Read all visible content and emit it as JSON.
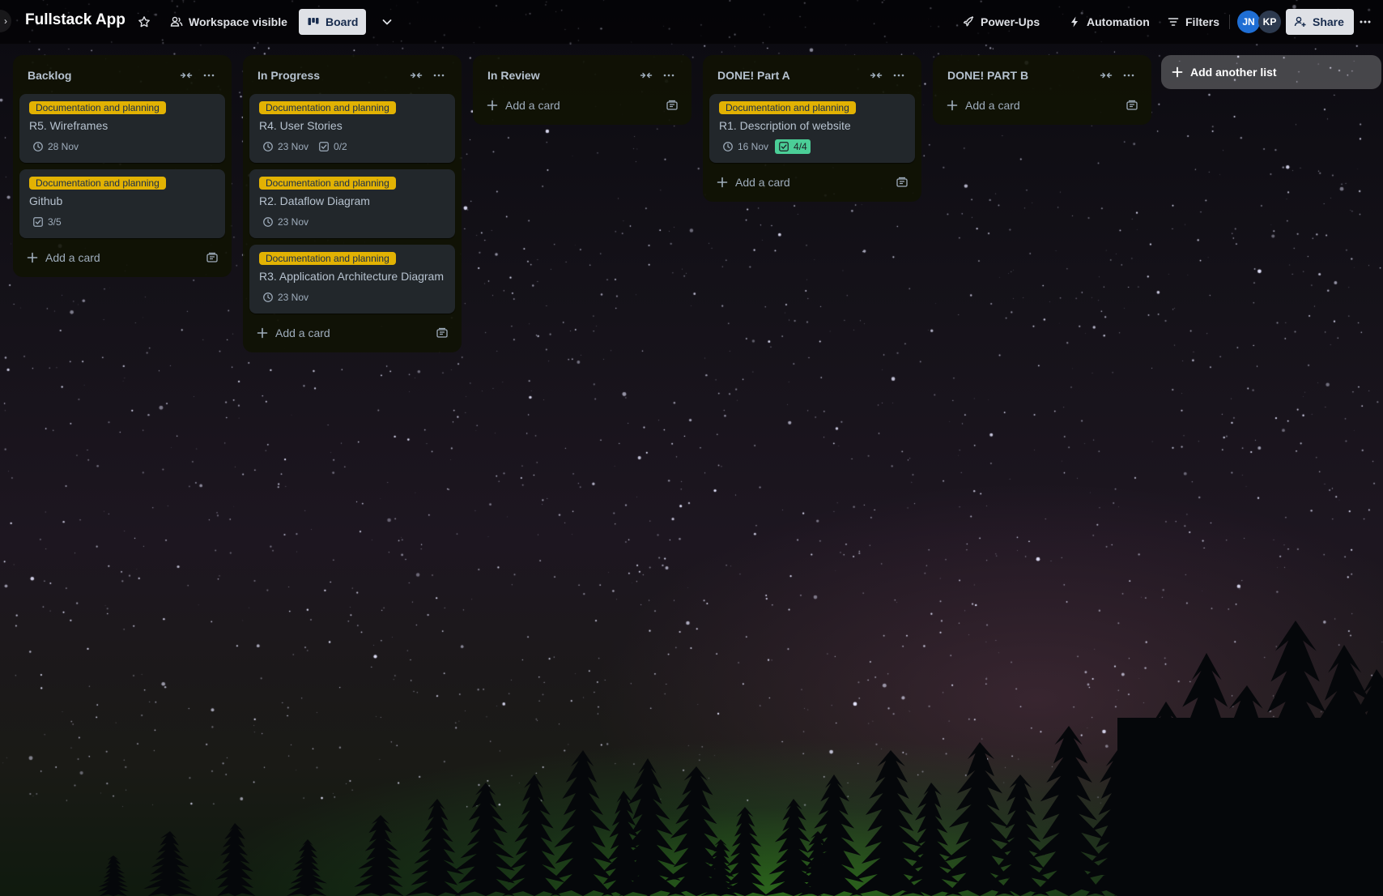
{
  "board": {
    "title": "Fullstack App",
    "visibility_label": "Workspace visible",
    "view_label": "Board"
  },
  "header": {
    "powerups_label": "Power-Ups",
    "automation_label": "Automation",
    "filters_label": "Filters",
    "share_label": "Share",
    "members": [
      {
        "initials": "JN",
        "color": "#1f6ed4"
      },
      {
        "initials": "KP",
        "color": "#2d3a4f"
      }
    ]
  },
  "label_color": "#e2b203",
  "lists": [
    {
      "title": "Backlog",
      "add_card_label": "Add a card",
      "cards": [
        {
          "label": "Documentation and planning",
          "title": "R5. Wireframes",
          "due": "28 Nov",
          "checklist": ""
        },
        {
          "label": "Documentation and planning",
          "title": "Github",
          "due": "",
          "checklist": "3/5"
        }
      ]
    },
    {
      "title": "In Progress",
      "add_card_label": "Add a card",
      "cards": [
        {
          "label": "Documentation and planning",
          "title": "R4. User Stories",
          "due": "23 Nov",
          "checklist": "0/2"
        },
        {
          "label": "Documentation and planning",
          "title": "R2. Dataflow Diagram",
          "due": "23 Nov",
          "checklist": ""
        },
        {
          "label": "Documentation and planning",
          "title": "R3. Application Architecture Diagram",
          "due": "23 Nov",
          "checklist": ""
        }
      ]
    },
    {
      "title": "In Review",
      "add_card_label": "Add a card",
      "cards": []
    },
    {
      "title": "DONE! Part A",
      "add_card_label": "Add a card",
      "cards": [
        {
          "label": "Documentation and planning",
          "title": "R1. Description of website",
          "due": "16 Nov",
          "checklist": "4/4",
          "checklist_complete": true
        }
      ]
    },
    {
      "title": "DONE! PART B",
      "add_card_label": "Add a card",
      "cards": []
    }
  ],
  "add_list_label": "Add another list"
}
